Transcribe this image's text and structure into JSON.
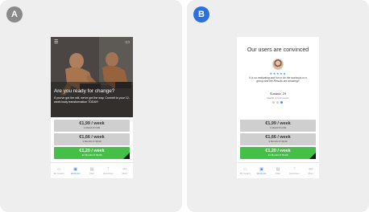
{
  "panel_a": {
    "badge": "A",
    "hero": {
      "title": "Are you ready for change?",
      "body": "If you've got the will, we've got the way. Commit to your 12-week body transformation TODAY!"
    },
    "plans": [
      {
        "price": "€1,99 / week",
        "term": "1 Month € 3,99",
        "highlight": false
      },
      {
        "price": "€1,66 / week",
        "term": "3 Months € 39,99",
        "highlight": false
      },
      {
        "price": "€1,20 / week",
        "term": "12 Months € 69,99",
        "highlight": true
      }
    ],
    "nav": [
      {
        "label": "My Coach",
        "icon": "list-icon",
        "glyph": "▭",
        "active": false
      },
      {
        "label": "Workouts",
        "icon": "workout-icon",
        "glyph": "▣",
        "active": true
      },
      {
        "label": "Plan",
        "icon": "calendar-icon",
        "glyph": "▤",
        "active": false
      },
      {
        "label": "Exercises",
        "icon": "dumbbell-icon",
        "glyph": "ᛉ",
        "active": false
      },
      {
        "label": "More",
        "icon": "more-icon",
        "glyph": "•••",
        "active": false
      }
    ]
  },
  "panel_b": {
    "badge": "B",
    "testimonial": {
      "heading": "Our users are convinced",
      "stars": "★★★★★",
      "quote": "It is so motivating and fun to do the workouts in a group and the Results are amazing!!",
      "name": "Susana, 29",
      "meta": "Madrid, 3 & 12 weeks"
    },
    "plans": [
      {
        "price": "€1,99 / week",
        "term": "1 Month € 3,99",
        "highlight": false
      },
      {
        "price": "€1,66 / week",
        "term": "3 Months € 39,99",
        "highlight": false
      },
      {
        "price": "€1,20 / week",
        "term": "12 Months € 69,99",
        "highlight": true
      }
    ],
    "nav": [
      {
        "label": "My Coach",
        "icon": "list-icon",
        "glyph": "▭",
        "active": false
      },
      {
        "label": "Workouts",
        "icon": "workout-icon",
        "glyph": "▣",
        "active": true
      },
      {
        "label": "Plan",
        "icon": "calendar-icon",
        "glyph": "▤",
        "active": false
      },
      {
        "label": "Exercises",
        "icon": "dumbbell-icon",
        "glyph": "ᛉ",
        "active": false
      },
      {
        "label": "More",
        "icon": "more-icon",
        "glyph": "•••",
        "active": false
      }
    ]
  },
  "colors": {
    "accent_green": "#44bf47",
    "accent_blue": "#4a90e2",
    "badge_a": "#8a8a8a",
    "badge_b": "#2b6fe0"
  }
}
